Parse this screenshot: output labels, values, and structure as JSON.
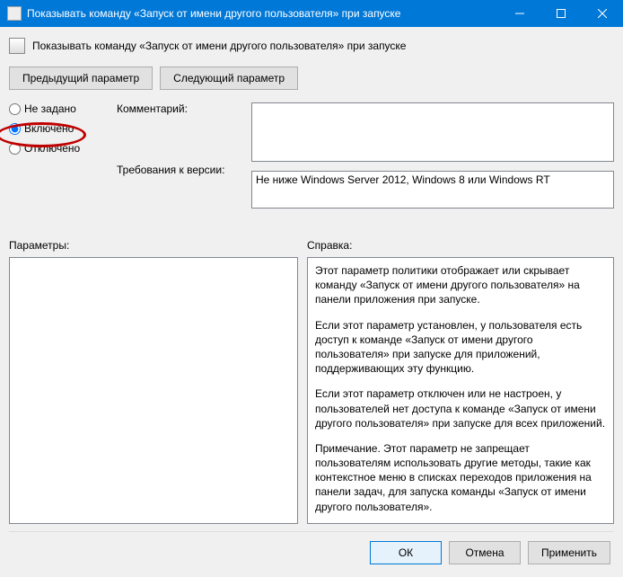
{
  "titlebar": {
    "title": "Показывать команду «Запуск от имени другого пользователя» при запуске"
  },
  "header": {
    "text": "Показывать команду «Запуск от имени другого пользователя» при запуске"
  },
  "nav": {
    "prev": "Предыдущий параметр",
    "next": "Следующий параметр"
  },
  "radios": {
    "not_configured": "Не задано",
    "enabled": "Включено",
    "disabled": "Отключено"
  },
  "labels": {
    "comment": "Комментарий:",
    "requirements": "Требования к версии:",
    "parameters": "Параметры:",
    "help": "Справка:"
  },
  "fields": {
    "comment": "",
    "requirements": "Не ниже Windows Server 2012, Windows 8 или Windows RT"
  },
  "help": {
    "p1": "Этот параметр политики отображает или скрывает команду «Запуск от имени другого пользователя» на панели приложения при запуске.",
    "p2": "Если этот параметр установлен, у пользователя есть доступ к команде «Запуск от имени другого пользователя» при запуске для приложений, поддерживающих эту функцию.",
    "p3": "Если этот параметр отключен или не настроен, у пользователей нет доступа к команде «Запуск от имени другого пользователя» при запуске для всех приложений.",
    "p4": "Примечание. Этот параметр не запрещает пользователям использовать другие методы, такие как контекстное меню в списках переходов приложения на панели задач, для запуска команды «Запуск от имени другого пользователя»."
  },
  "footer": {
    "ok": "ОК",
    "cancel": "Отмена",
    "apply": "Применить"
  }
}
